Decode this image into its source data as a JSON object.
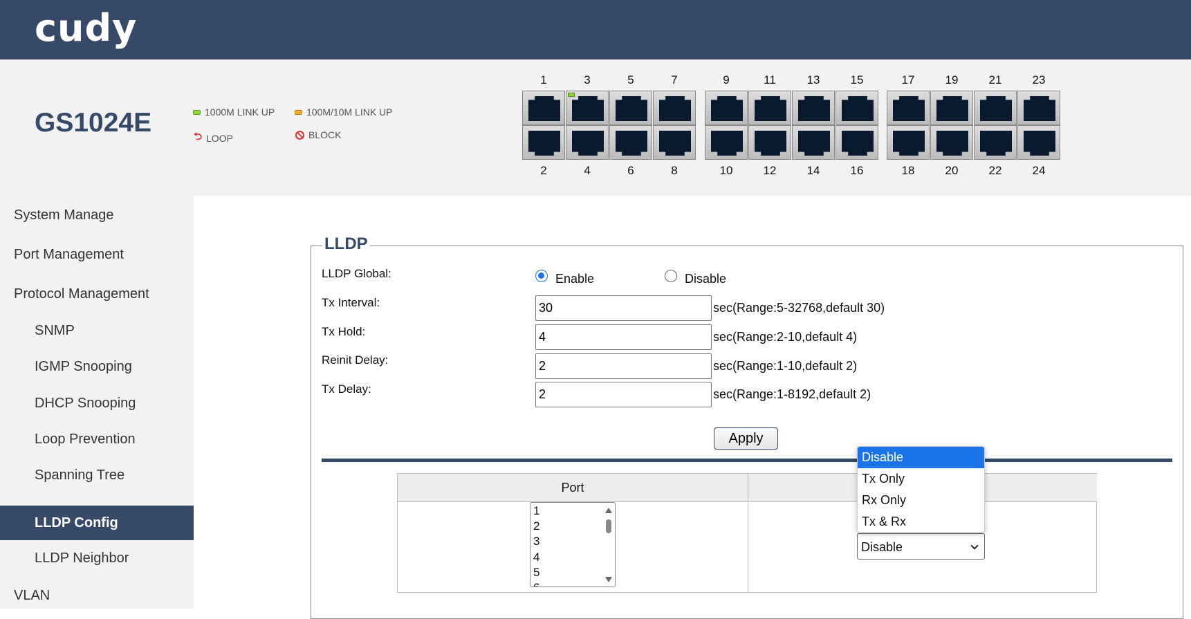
{
  "brand": {
    "logo_text": "cudy"
  },
  "device": {
    "model": "GS1024E",
    "legend": [
      {
        "label": "1000M LINK UP",
        "icon": "led-green-icon"
      },
      {
        "label": "100M/10M LINK UP",
        "icon": "led-orange-icon"
      },
      {
        "label": "LOOP",
        "icon": "loop-icon"
      },
      {
        "label": "BLOCK",
        "icon": "block-icon"
      }
    ],
    "top_ports": [
      "1",
      "3",
      "5",
      "7",
      "9",
      "11",
      "13",
      "15",
      "17",
      "19",
      "21",
      "23"
    ],
    "bottom_ports": [
      "2",
      "4",
      "6",
      "8",
      "10",
      "12",
      "14",
      "16",
      "18",
      "20",
      "22",
      "24"
    ],
    "link_up_ports": [
      "3"
    ]
  },
  "sidebar": {
    "items": [
      {
        "label": "System Manage"
      },
      {
        "label": "Port Management"
      },
      {
        "label": "Protocol Management"
      },
      {
        "label": "SNMP"
      },
      {
        "label": "IGMP Snooping"
      },
      {
        "label": "DHCP Snooping"
      },
      {
        "label": "Loop Prevention"
      },
      {
        "label": "Spanning Tree"
      },
      {
        "label": "LLDP Config"
      },
      {
        "label": "LLDP Neighbor"
      },
      {
        "label": "VLAN"
      }
    ],
    "active": "LLDP Config"
  },
  "lldp": {
    "title": "LLDP",
    "global_label": "LLDP Global:",
    "enable_label": "Enable",
    "disable_label": "Disable",
    "global_value": "Enable",
    "tx_interval": {
      "label": "Tx Interval:",
      "value": "30",
      "hint": "sec(Range:5-32768,default 30)"
    },
    "tx_hold": {
      "label": "Tx Hold:",
      "value": "4",
      "hint": "sec(Range:2-10,default 4)"
    },
    "reinit_delay": {
      "label": "Reinit Delay:",
      "value": "2",
      "hint": "sec(Range:1-10,default 2)"
    },
    "tx_delay": {
      "label": "Tx Delay:",
      "value": "2",
      "hint": "sec(Range:1-8192,default 2)"
    },
    "apply_label": "Apply"
  },
  "port_table": {
    "port_header": "Port",
    "ports_list": [
      "1",
      "2",
      "3",
      "4",
      "5",
      "6"
    ],
    "mode_value": "Disable",
    "mode_options": [
      "Disable",
      "Tx Only",
      "Rx Only",
      "Tx & Rx"
    ],
    "highlighted_option": "Disable"
  }
}
